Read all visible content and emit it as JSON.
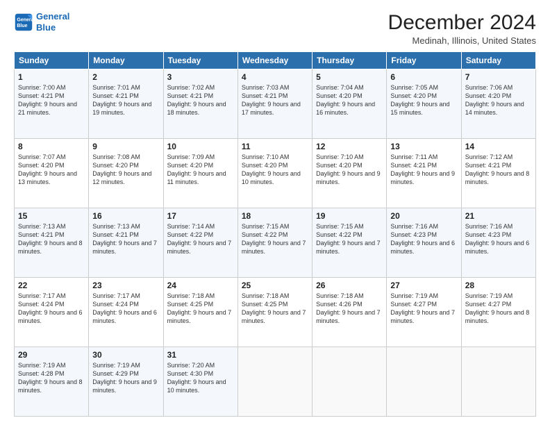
{
  "logo": {
    "line1": "General",
    "line2": "Blue"
  },
  "header": {
    "title": "December 2024",
    "subtitle": "Medinah, Illinois, United States"
  },
  "days_of_week": [
    "Sunday",
    "Monday",
    "Tuesday",
    "Wednesday",
    "Thursday",
    "Friday",
    "Saturday"
  ],
  "weeks": [
    [
      {
        "day": "1",
        "sunrise": "7:00 AM",
        "sunset": "4:21 PM",
        "daylight": "9 hours and 21 minutes."
      },
      {
        "day": "2",
        "sunrise": "7:01 AM",
        "sunset": "4:21 PM",
        "daylight": "9 hours and 19 minutes."
      },
      {
        "day": "3",
        "sunrise": "7:02 AM",
        "sunset": "4:21 PM",
        "daylight": "9 hours and 18 minutes."
      },
      {
        "day": "4",
        "sunrise": "7:03 AM",
        "sunset": "4:21 PM",
        "daylight": "9 hours and 17 minutes."
      },
      {
        "day": "5",
        "sunrise": "7:04 AM",
        "sunset": "4:20 PM",
        "daylight": "9 hours and 16 minutes."
      },
      {
        "day": "6",
        "sunrise": "7:05 AM",
        "sunset": "4:20 PM",
        "daylight": "9 hours and 15 minutes."
      },
      {
        "day": "7",
        "sunrise": "7:06 AM",
        "sunset": "4:20 PM",
        "daylight": "9 hours and 14 minutes."
      }
    ],
    [
      {
        "day": "8",
        "sunrise": "7:07 AM",
        "sunset": "4:20 PM",
        "daylight": "9 hours and 13 minutes."
      },
      {
        "day": "9",
        "sunrise": "7:08 AM",
        "sunset": "4:20 PM",
        "daylight": "9 hours and 12 minutes."
      },
      {
        "day": "10",
        "sunrise": "7:09 AM",
        "sunset": "4:20 PM",
        "daylight": "9 hours and 11 minutes."
      },
      {
        "day": "11",
        "sunrise": "7:10 AM",
        "sunset": "4:20 PM",
        "daylight": "9 hours and 10 minutes."
      },
      {
        "day": "12",
        "sunrise": "7:10 AM",
        "sunset": "4:20 PM",
        "daylight": "9 hours and 9 minutes."
      },
      {
        "day": "13",
        "sunrise": "7:11 AM",
        "sunset": "4:21 PM",
        "daylight": "9 hours and 9 minutes."
      },
      {
        "day": "14",
        "sunrise": "7:12 AM",
        "sunset": "4:21 PM",
        "daylight": "9 hours and 8 minutes."
      }
    ],
    [
      {
        "day": "15",
        "sunrise": "7:13 AM",
        "sunset": "4:21 PM",
        "daylight": "9 hours and 8 minutes."
      },
      {
        "day": "16",
        "sunrise": "7:13 AM",
        "sunset": "4:21 PM",
        "daylight": "9 hours and 7 minutes."
      },
      {
        "day": "17",
        "sunrise": "7:14 AM",
        "sunset": "4:22 PM",
        "daylight": "9 hours and 7 minutes."
      },
      {
        "day": "18",
        "sunrise": "7:15 AM",
        "sunset": "4:22 PM",
        "daylight": "9 hours and 7 minutes."
      },
      {
        "day": "19",
        "sunrise": "7:15 AM",
        "sunset": "4:22 PM",
        "daylight": "9 hours and 7 minutes."
      },
      {
        "day": "20",
        "sunrise": "7:16 AM",
        "sunset": "4:23 PM",
        "daylight": "9 hours and 6 minutes."
      },
      {
        "day": "21",
        "sunrise": "7:16 AM",
        "sunset": "4:23 PM",
        "daylight": "9 hours and 6 minutes."
      }
    ],
    [
      {
        "day": "22",
        "sunrise": "7:17 AM",
        "sunset": "4:24 PM",
        "daylight": "9 hours and 6 minutes."
      },
      {
        "day": "23",
        "sunrise": "7:17 AM",
        "sunset": "4:24 PM",
        "daylight": "9 hours and 6 minutes."
      },
      {
        "day": "24",
        "sunrise": "7:18 AM",
        "sunset": "4:25 PM",
        "daylight": "9 hours and 7 minutes."
      },
      {
        "day": "25",
        "sunrise": "7:18 AM",
        "sunset": "4:25 PM",
        "daylight": "9 hours and 7 minutes."
      },
      {
        "day": "26",
        "sunrise": "7:18 AM",
        "sunset": "4:26 PM",
        "daylight": "9 hours and 7 minutes."
      },
      {
        "day": "27",
        "sunrise": "7:19 AM",
        "sunset": "4:27 PM",
        "daylight": "9 hours and 7 minutes."
      },
      {
        "day": "28",
        "sunrise": "7:19 AM",
        "sunset": "4:27 PM",
        "daylight": "9 hours and 8 minutes."
      }
    ],
    [
      {
        "day": "29",
        "sunrise": "7:19 AM",
        "sunset": "4:28 PM",
        "daylight": "9 hours and 8 minutes."
      },
      {
        "day": "30",
        "sunrise": "7:19 AM",
        "sunset": "4:29 PM",
        "daylight": "9 hours and 9 minutes."
      },
      {
        "day": "31",
        "sunrise": "7:20 AM",
        "sunset": "4:30 PM",
        "daylight": "9 hours and 10 minutes."
      },
      null,
      null,
      null,
      null
    ]
  ]
}
